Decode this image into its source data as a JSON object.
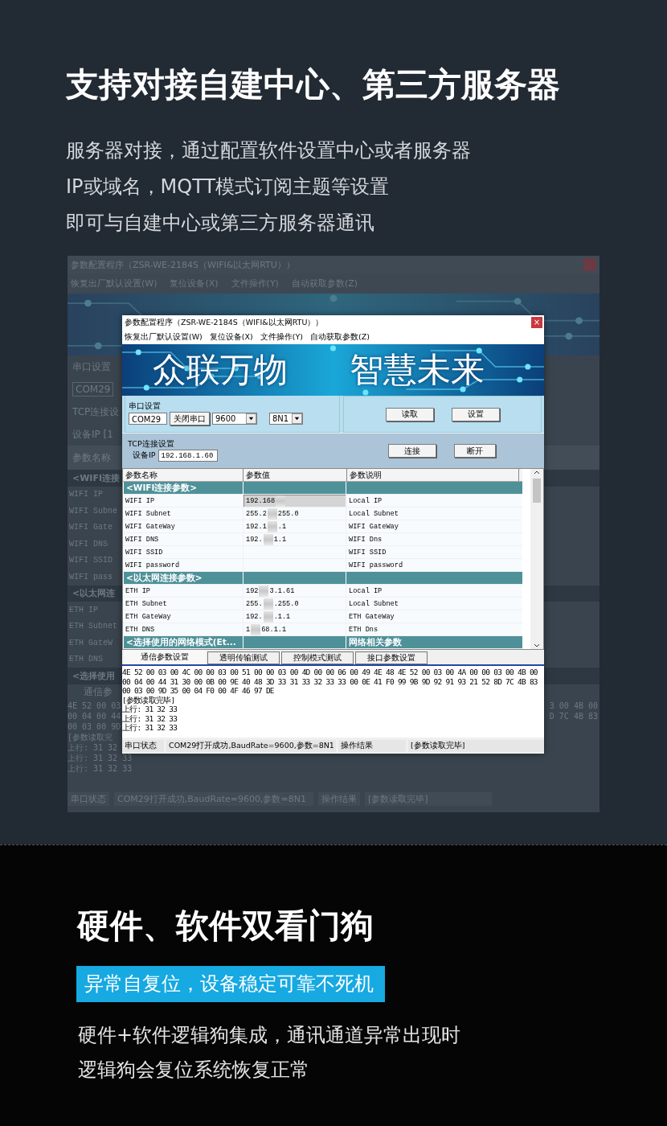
{
  "intro": {
    "heading": "支持对接自建中心、第三方服务器",
    "paragraph_lines": [
      "服务器对接，通过配置软件设置中心或者服务器",
      "IP或域名，MQTT模式订阅主题等设置",
      "即可与自建中心或第三方服务器通讯"
    ]
  },
  "backdrop": {
    "title": "参数配置程序（ZSR-WE-2184S（WIFI&以太网RTU））",
    "menu": [
      "恢复出厂默认设置(W)",
      "复位设备(X)",
      "文件操作(Y)",
      "自动获取参数(Z)"
    ],
    "strip": [
      {
        "kind": "label",
        "text": "串口设置"
      },
      {
        "kind": "field",
        "text": "COM29"
      },
      {
        "kind": "label",
        "text": "TCP连接设"
      },
      {
        "kind": "label",
        "text": "设备IP  [1"
      },
      {
        "kind": "header",
        "text": "参数名称"
      },
      {
        "kind": "section",
        "text": "<WIFI连接"
      },
      {
        "kind": "row",
        "text": "WIFI IP"
      },
      {
        "kind": "row",
        "text": "WIFI Subne"
      },
      {
        "kind": "row",
        "text": "WIFI Gate"
      },
      {
        "kind": "row",
        "text": "WIFI DNS"
      },
      {
        "kind": "row",
        "text": "WIFI SSID"
      },
      {
        "kind": "row",
        "text": "WIFI pass"
      },
      {
        "kind": "section",
        "text": "<以太网连"
      },
      {
        "kind": "row",
        "text": "ETH IP"
      },
      {
        "kind": "row",
        "text": "ETH Subnet"
      },
      {
        "kind": "row",
        "text": "ETH GateW"
      },
      {
        "kind": "row",
        "text": "ETH DNS"
      },
      {
        "kind": "section",
        "text": "<选择使用"
      },
      {
        "kind": "tab",
        "text": "通信参"
      },
      {
        "kind": "log",
        "text": "4E 52 00 03",
        "right_text": "3 00 4B 00"
      },
      {
        "kind": "log",
        "text": "00 04 00 44",
        "right_text": "D 7C 4B 83"
      },
      {
        "kind": "log",
        "text": "00 03 00 9D"
      },
      {
        "kind": "log",
        "text": "[参数读取完"
      },
      {
        "kind": "log",
        "text": "上行: 31 32"
      },
      {
        "kind": "log",
        "text": "上行: 31 32 33"
      },
      {
        "kind": "log",
        "text": "上行: 31 32 33"
      }
    ],
    "status_bar": [
      "串口状态",
      "COM29打开成功,BaudRate=9600,参数=8N1",
      "操作结果",
      "[参数读取完毕]"
    ]
  },
  "window": {
    "title": "参数配置程序（ZSR-WE-2184S（WIFI&以太网RTU））",
    "close": "×",
    "menu": [
      "恢复出厂默认设置(W)",
      "复位设备(X)",
      "文件操作(Y)",
      "自动获取参数(Z)"
    ],
    "banner": [
      "众联万物",
      "智慧未来"
    ],
    "serial": {
      "group_label": "串口设置",
      "port": "COM29",
      "open_button": "关闭串口",
      "baud": "9600",
      "format": "8N1",
      "read_button": "读取",
      "set_button": "设置"
    },
    "tcp": {
      "group_label": "TCP连接设置",
      "ip_label": "设备IP",
      "ip_value": "192.168.1.60",
      "connect_button": "连接",
      "disconnect_button": "断开"
    },
    "table": {
      "columns": [
        "参数名称",
        "参数值",
        "参数说明"
      ],
      "rows": [
        {
          "kind": "section",
          "name": "<WIFI连接参数>",
          "selected": false
        },
        {
          "kind": "param",
          "name": "WIFI IP",
          "value_parts": [
            "192.168"
          ],
          "description": "Local IP",
          "selected": true
        },
        {
          "kind": "param",
          "name": "WIFI Subnet",
          "value_parts": [
            "255.2",
            "255.0"
          ],
          "description": "Local Subnet",
          "selected": false
        },
        {
          "kind": "param",
          "name": "WIFI GateWay",
          "value_parts": [
            "192.1",
            ".1"
          ],
          "description": "WIFI GateWay",
          "selected": false
        },
        {
          "kind": "param",
          "name": "WIFI DNS",
          "value_parts": [
            "192.",
            "1.1"
          ],
          "description": "WIFI Dns",
          "selected": false
        },
        {
          "kind": "param",
          "name": "WIFI SSID",
          "description": "WIFI SSID",
          "selected": false
        },
        {
          "kind": "param",
          "name": "WIFI password",
          "description": "WIFI password",
          "selected": false
        },
        {
          "kind": "section",
          "name": "<以太网连接参数>",
          "selected": false
        },
        {
          "kind": "param",
          "name": "ETH IP",
          "value_parts": [
            "192",
            "3.1.61"
          ],
          "description": "Local IP",
          "selected": false
        },
        {
          "kind": "param",
          "name": "ETH Subnet",
          "value_parts": [
            "255.",
            ".255.0"
          ],
          "description": "Local Subnet",
          "selected": false
        },
        {
          "kind": "param",
          "name": "ETH GateWay",
          "value_parts": [
            "192.",
            ".1.1"
          ],
          "description": "ETH GateWay",
          "selected": false
        },
        {
          "kind": "param",
          "name": "ETH DNS",
          "value_parts": [
            "1",
            "68.1.1"
          ],
          "description": "ETH Dns",
          "selected": false
        },
        {
          "kind": "section",
          "name": "<选择使用的网络模式(Et...",
          "description": "网络相关参数",
          "selected": false
        }
      ]
    },
    "tabs": [
      {
        "label": "通信参数设置",
        "selected": true
      },
      {
        "label": "透明传输测试",
        "selected": false
      },
      {
        "label": "控制模式测试",
        "selected": false
      },
      {
        "label": "接口参数设置",
        "selected": false
      }
    ],
    "log_lines": [
      "4E 52 00 03 00 4C 00 00 03 00 51 00 00 03 00 4D 00 00 06 00 49 4E 48 4E 52 00 03 00 4A 00 00 03 00 4B 00",
      "00 04 00 44 31 30 00 0B 00 9E 40 48 3D 33 31 33 32 33 33 00 0E 41 F0 99 9B 9D 92 91 93 21 52 8D 7C 4B 83",
      "00 03 00 9D 35 00 04 F0 00 4F 46 97 DE",
      "[参数读取完毕]",
      "上行: 31 32 33",
      "上行: 31 32 33",
      "上行: 31 32 33"
    ],
    "status_bar": [
      "串口状态",
      "COM29打开成功,BaudRate=9600,参数=8N1",
      "操作结果",
      "[参数读取完毕]"
    ]
  },
  "watchdog": {
    "heading": "硬件、软件双看门狗",
    "tag": "异常自复位，设备稳定可靠不死机",
    "paragraph_lines": [
      "硬件+软件逻辑狗集成，通讯通道异常出现时",
      "逻辑狗会复位系统恢复正常"
    ]
  }
}
